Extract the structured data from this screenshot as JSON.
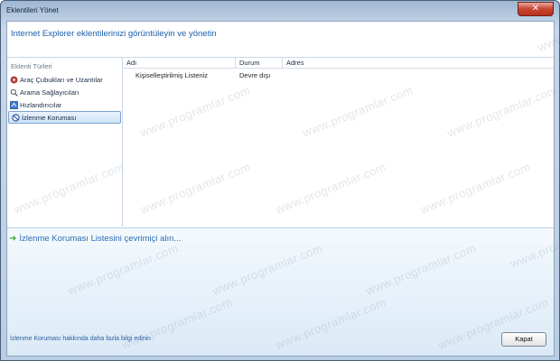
{
  "window": {
    "title": "Eklentileri Yönet",
    "close_glyph": "✕"
  },
  "header": {
    "text": "Internet Explorer eklentilerinizi görüntüleyin ve yönetin"
  },
  "sidebar": {
    "title": "Eklenti Türleri",
    "items": [
      {
        "label": "Araç Çubukları ve Uzantılar",
        "icon": "gear-icon"
      },
      {
        "label": "Arama Sağlayıcıları",
        "icon": "search-icon"
      },
      {
        "label": "Hızlandırıcılar",
        "icon": "accelerator-icon"
      },
      {
        "label": "İzlenme Koruması",
        "icon": "no-tracking-icon",
        "selected": true
      }
    ]
  },
  "list": {
    "columns": [
      "Adı",
      "Durum",
      "Adres"
    ],
    "rows": [
      {
        "name": "Kişiselleştirilmiş Listeniz",
        "status": "Devre dışı",
        "address": ""
      }
    ]
  },
  "bottom": {
    "link": "İzlenme Koruması Listesini çevrimiçi alın...",
    "more_info": "İzlenme Koruması hakkında daha fazla bilgi edinin",
    "close_label": "Kapat"
  },
  "watermark": "www.programlar.com",
  "colors": {
    "accent": "#1a5fa8",
    "link_green": "#3fa630"
  }
}
